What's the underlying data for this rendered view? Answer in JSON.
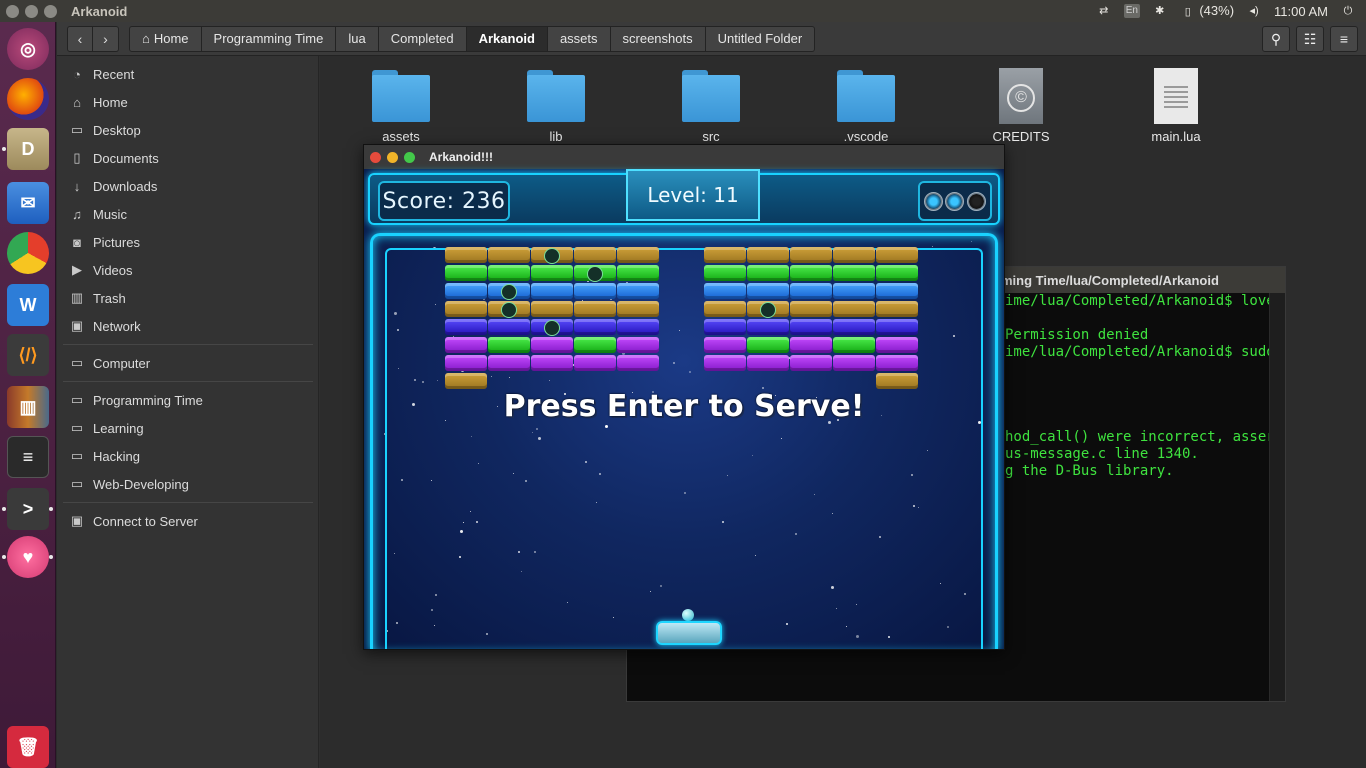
{
  "topbar": {
    "window_title": "Arkanoid",
    "lang_indicator": "En",
    "battery": "(43%)",
    "time": "11:00 AM"
  },
  "launcher": {
    "icons": [
      "ubuntu-icon",
      "firefox-icon",
      "files-icon",
      "mail-icon",
      "chrome-icon",
      "wps-writer-icon",
      "vscode-icon",
      "library-icon",
      "server-icon",
      "terminal-icon",
      "heart-app-icon",
      "trash-icon"
    ]
  },
  "nautilus": {
    "breadcrumbs": [
      "Home",
      "Programming Time",
      "lua",
      "Completed",
      "Arkanoid",
      "assets",
      "screenshots",
      "Untitled Folder"
    ],
    "active_crumb": "Arkanoid",
    "sidebar": {
      "places": [
        "Recent",
        "Home",
        "Desktop",
        "Documents",
        "Downloads",
        "Music",
        "Pictures",
        "Videos",
        "Trash",
        "Network"
      ],
      "devices": [
        "Computer"
      ],
      "bookmarks": [
        "Programming Time",
        "Learning",
        "Hacking",
        "Web-Developing"
      ],
      "connect": "Connect to Server"
    },
    "files": [
      {
        "name": "assets",
        "type": "folder"
      },
      {
        "name": "lib",
        "type": "folder"
      },
      {
        "name": "src",
        "type": "folder"
      },
      {
        "name": ".vscode",
        "type": "folder"
      },
      {
        "name": "CREDITS",
        "type": "credits"
      },
      {
        "name": "main.lua",
        "type": "text"
      }
    ]
  },
  "terminal": {
    "title": "ming Time/lua/Completed/Arkanoid",
    "lines": [
      "ime/lua/Completed/Arkanoid$ love",
      "",
      "Permission denied",
      "ime/lua/Completed/Arkanoid$ sudo",
      "",
      "",
      "",
      "",
      "hod_call() were incorrect, assert",
      "us-message.c line 1340.",
      "g the D-Bus library."
    ]
  },
  "game": {
    "window_title": "Arkanoid!!!",
    "score_text": "Score: 236",
    "level_text": "Level: 11",
    "lives_remaining": 2,
    "lives_total": 3,
    "banner": "Press Enter to Serve!",
    "colors": {
      "neon": "#19d2ff",
      "gold": "#d0a23a",
      "green": "#4ef04e",
      "blue": "#4aa8ff",
      "indigo": "#5a4dff",
      "purple": "#c64cff"
    },
    "left_block": [
      [
        "gold",
        "gold",
        "gold-key",
        "gold",
        "gold"
      ],
      [
        "green",
        "green",
        "green",
        "green-key",
        "green"
      ],
      [
        "blue",
        "blue-key",
        "blue",
        "blue",
        "blue"
      ],
      [
        "gold",
        "gold-key",
        "gold",
        "gold",
        "gold"
      ],
      [
        "indigo",
        "indigo",
        "indigo-key",
        "indigo",
        "indigo"
      ],
      [
        "purple",
        "green",
        "purple",
        "green",
        "purple"
      ],
      [
        "purple",
        "purple",
        "purple",
        "purple",
        "purple"
      ],
      [
        "gold",
        "",
        "",
        "",
        ""
      ]
    ],
    "right_block": [
      [
        "gold",
        "gold",
        "gold",
        "gold",
        "gold"
      ],
      [
        "green",
        "green",
        "green",
        "green",
        "green"
      ],
      [
        "blue",
        "blue",
        "blue",
        "blue",
        "blue"
      ],
      [
        "gold",
        "gold-key",
        "gold",
        "gold",
        "gold"
      ],
      [
        "indigo",
        "indigo",
        "indigo",
        "indigo",
        "indigo"
      ],
      [
        "purple",
        "green",
        "purple",
        "green",
        "purple"
      ],
      [
        "purple",
        "purple",
        "purple",
        "purple",
        "purple"
      ],
      [
        "",
        "",
        "",
        "",
        "gold"
      ]
    ]
  }
}
